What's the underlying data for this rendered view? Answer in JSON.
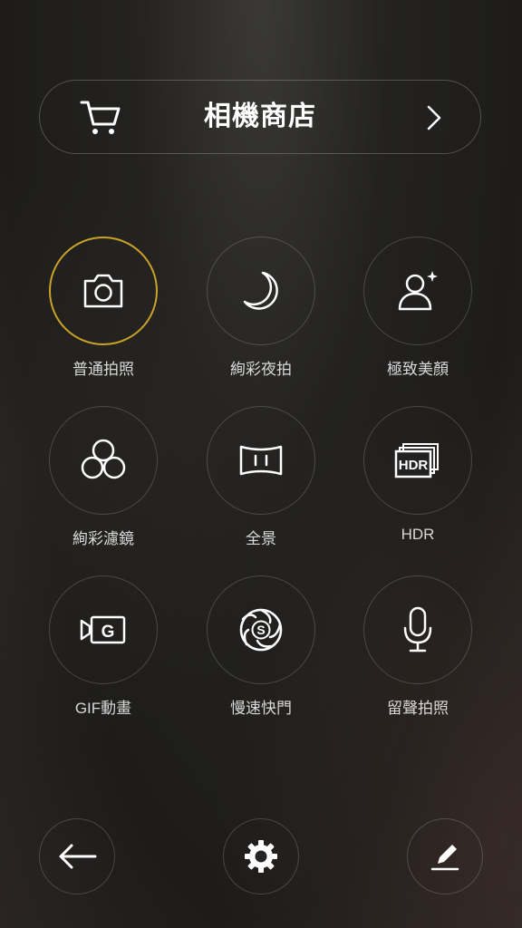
{
  "store": {
    "title": "相機商店"
  },
  "modes": [
    {
      "label": "普通拍照",
      "icon": "camera-icon",
      "selected": true
    },
    {
      "label": "絢彩夜拍",
      "icon": "moon-icon",
      "selected": false
    },
    {
      "label": "極致美顏",
      "icon": "beauty-portrait-icon",
      "selected": false
    },
    {
      "label": "絢彩濾鏡",
      "icon": "filter-circles-icon",
      "selected": false
    },
    {
      "label": "全景",
      "icon": "panorama-icon",
      "selected": false
    },
    {
      "label": "HDR",
      "icon": "hdr-icon",
      "icon_text": "HDR",
      "selected": false
    },
    {
      "label": "GIF動畫",
      "icon": "gif-video-icon",
      "icon_text": "G",
      "selected": false
    },
    {
      "label": "慢速快門",
      "icon": "shutter-icon",
      "icon_text": "S",
      "selected": false
    },
    {
      "label": "留聲拍照",
      "icon": "microphone-icon",
      "selected": false
    }
  ],
  "bottom_bar": {
    "back_icon": "back-arrow-icon",
    "settings_icon": "gear-icon",
    "edit_icon": "pencil-icon"
  },
  "colors": {
    "selected_ring": "#c9a227",
    "text": "#ffffff",
    "label": "#d8d8d8"
  }
}
